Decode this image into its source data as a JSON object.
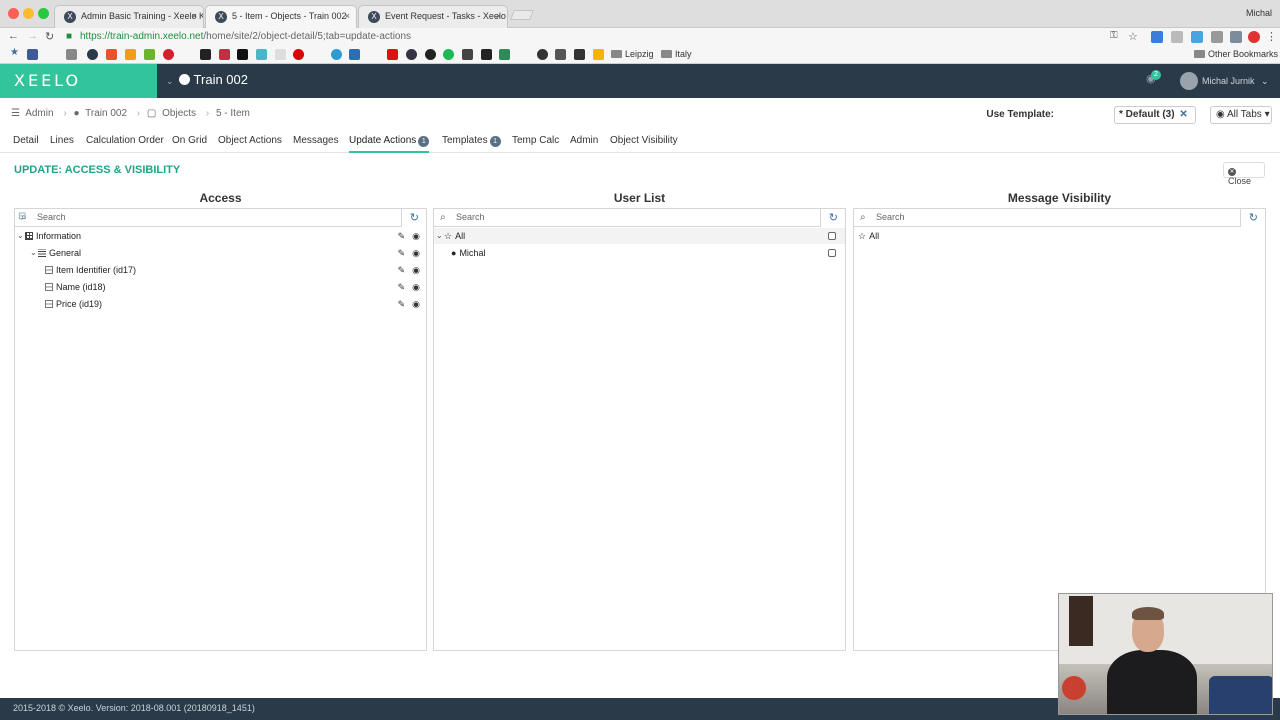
{
  "browser": {
    "tabs": [
      {
        "title": "Admin Basic Training - Xeelo K",
        "active": false
      },
      {
        "title": "5 - Item - Objects - Train 002",
        "active": true
      },
      {
        "title": "Event Request - Tasks - Xeelo",
        "active": false
      }
    ],
    "close_glyph": "×",
    "profile_name": "Michal",
    "url_scheme": "https://",
    "url_host": "train-admin.xeelo.net",
    "url_path": "/home/site/2/object-detail/5;tab=update-actions",
    "bookmarks": [
      "Leipzig",
      "Italy"
    ],
    "other_bookmarks": "Other Bookmarks"
  },
  "header": {
    "logo": "XEELO",
    "site_name": "Train 002",
    "notification_count": "2",
    "user_name": "Michal Jurnik",
    "accent_color": "#32c49a",
    "bar_color": "#2b3a48"
  },
  "breadcrumb": {
    "items": [
      "Admin",
      "Train 002",
      "Objects",
      "5 - Item"
    ]
  },
  "template": {
    "label": "Use Template:",
    "selected": "* Default (3)",
    "tabs_filter": "All Tabs"
  },
  "tabs": [
    {
      "label": "Detail"
    },
    {
      "label": "Lines"
    },
    {
      "label": "Calculation Order"
    },
    {
      "label": "On Grid"
    },
    {
      "label": "Object Actions"
    },
    {
      "label": "Messages"
    },
    {
      "label": "Update Actions",
      "count": "1",
      "active": true
    },
    {
      "label": "Templates",
      "count": "1"
    },
    {
      "label": "Temp Calc"
    },
    {
      "label": "Admin"
    },
    {
      "label": "Object Visibility"
    }
  ],
  "section": {
    "title": "UPDATE: ACCESS & VISIBILITY",
    "close_label": "Close"
  },
  "panels": {
    "access": {
      "title": "Access",
      "search_placeholder": "Search",
      "tree": [
        {
          "label": "Information",
          "level": 0,
          "icon": "grid-icon"
        },
        {
          "label": "General",
          "level": 1,
          "icon": "list-icon"
        },
        {
          "label": "Item Identifier (id17)",
          "level": 2,
          "icon": "field-icon"
        },
        {
          "label": "Name (id18)",
          "level": 2,
          "icon": "field-icon"
        },
        {
          "label": "Price (id19)",
          "level": 2,
          "icon": "field-icon"
        }
      ]
    },
    "users": {
      "title": "User List",
      "search_placeholder": "Search",
      "tree": [
        {
          "label": "All",
          "icon": "star-icon"
        },
        {
          "label": "Michal",
          "icon": "user-icon"
        }
      ]
    },
    "visibility": {
      "title": "Message Visibility",
      "search_placeholder": "Search",
      "tree": [
        {
          "label": "All",
          "icon": "star-icon"
        }
      ]
    }
  },
  "footer": {
    "text": "2015-2018 © Xeelo. Version: 2018-08.001 (20180918_1451)"
  }
}
